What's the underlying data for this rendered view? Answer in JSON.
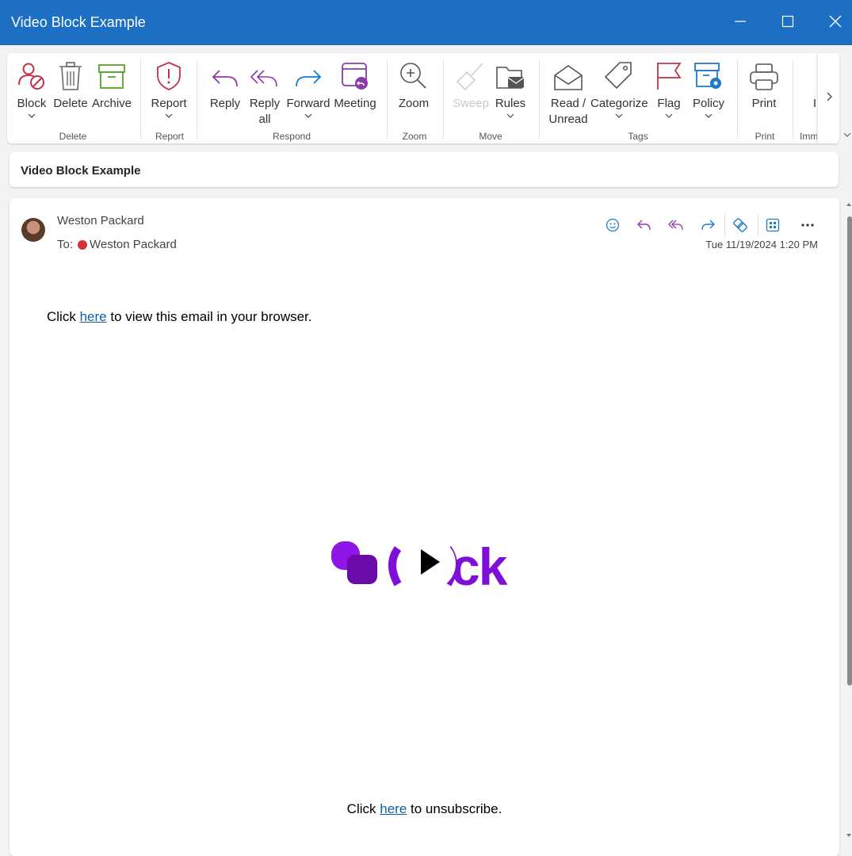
{
  "window": {
    "title": "Video Block Example"
  },
  "ribbon": {
    "buttons": {
      "block": "Block",
      "delete": "Delete",
      "archive": "Archive",
      "report": "Report",
      "reply": "Reply",
      "reply_all_1": "Reply",
      "reply_all_2": "all",
      "forward": "Forward",
      "meeting": "Meeting",
      "zoom": "Zoom",
      "sweep": "Sweep",
      "rules": "Rules",
      "read_unread_1": "Read /",
      "read_unread_2": "Unread",
      "categorize": "Categorize",
      "flag": "Flag",
      "policy": "Policy",
      "print": "Print",
      "immersive_partial": "I"
    },
    "groups": {
      "delete": "Delete",
      "report": "Report",
      "respond": "Respond",
      "zoom": "Zoom",
      "move": "Move",
      "tags": "Tags",
      "print": "Print",
      "immersive_partial": "Imm"
    }
  },
  "subject": "Video Block Example",
  "message": {
    "sender": "Weston Packard",
    "to_label": "To:",
    "recipient": "Weston Packard",
    "date": "Tue 11/19/2024 1:20 PM",
    "body": {
      "line1_pre": "Click",
      "line1_link": "here",
      "line1_post": "to view this email in your browser.",
      "line2_pre": "Click",
      "line2_link": "here",
      "line2_post": "to unsubscribe.",
      "logo_text": "ck"
    }
  },
  "colors": {
    "titlebar": "#1d6fc4",
    "brand_purple": "#7e0fd8",
    "link": "#0f5fa6",
    "presence": "#d13438"
  },
  "icons": [
    "minimize-icon",
    "maximize-icon",
    "close-icon",
    "block-icon",
    "trash-icon",
    "archive-icon",
    "report-icon",
    "reply-icon",
    "reply-all-icon",
    "forward-icon",
    "meeting-icon",
    "zoom-icon",
    "sweep-icon",
    "rules-icon",
    "envelope-icon",
    "tag-icon",
    "flag-icon",
    "policy-icon",
    "printer-icon",
    "chevron-right-icon",
    "emoji-icon",
    "more-icon"
  ]
}
